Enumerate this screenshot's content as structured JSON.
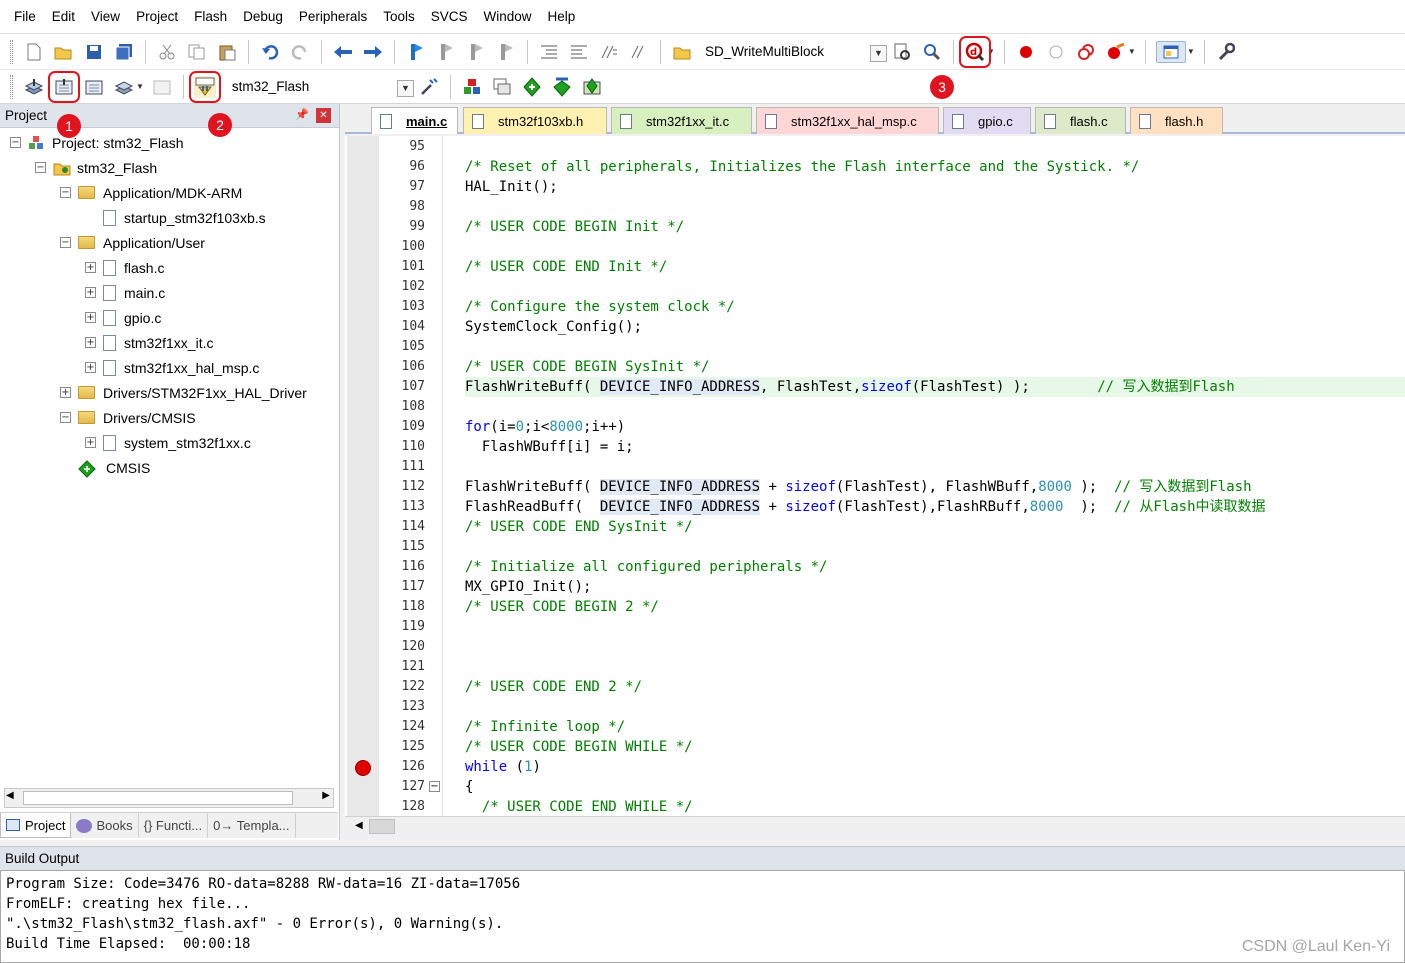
{
  "menubar": {
    "items": [
      "File",
      "Edit",
      "View",
      "Project",
      "Flash",
      "Debug",
      "Peripherals",
      "Tools",
      "SVCS",
      "Window",
      "Help"
    ]
  },
  "toolbar1": {
    "target_combo": "SD_WriteMultiBlock",
    "icons": [
      "new-file-icon",
      "open-icon",
      "save-icon",
      "save-all-icon",
      "cut-icon",
      "copy-icon",
      "paste-icon",
      "undo-icon",
      "redo-icon",
      "nav-back-icon",
      "nav-forward-icon",
      "bookmark-icon",
      "prev-bookmark-icon",
      "next-bookmark-icon",
      "clear-bookmarks-icon",
      "indent-icon",
      "unindent-icon",
      "comment-icon",
      "uncomment-icon",
      "find-in-files-icon",
      "find-icon",
      "incremental-find-icon",
      "debug-session-icon",
      "breakpoint-icon",
      "disable-breakpoint-icon",
      "disable-all-breakpoints-icon",
      "kill-breakpoints-icon",
      "window-layout-icon",
      "configure-icon"
    ]
  },
  "toolbar2": {
    "target_combo": "stm32_Flash",
    "icons": [
      "translate-icon",
      "build-icon",
      "rebuild-icon",
      "batch-build-icon",
      "stop-build-icon",
      "download-icon",
      "target-options-icon",
      "manage-components-icon",
      "file-extensions-icon",
      "select-packs-icon",
      "pack-installer-icon",
      "event-recorder-icon"
    ],
    "download_label": "LOAD"
  },
  "badges": [
    "1",
    "2",
    "3"
  ],
  "project_panel": {
    "title": "Project",
    "tree": [
      {
        "label": "Project: stm32_Flash",
        "level": 0,
        "expander": "⊟",
        "icon": "project"
      },
      {
        "label": "stm32_Flash",
        "level": 1,
        "expander": "⊟",
        "icon": "target"
      },
      {
        "label": "Application/MDK-ARM",
        "level": 2,
        "expander": "⊟",
        "icon": "folder"
      },
      {
        "label": "startup_stm32f103xb.s",
        "level": 3,
        "expander": "",
        "icon": "file"
      },
      {
        "label": "Application/User",
        "level": 2,
        "expander": "⊟",
        "icon": "folder"
      },
      {
        "label": "flash.c",
        "level": 3,
        "expander": "⊞",
        "icon": "file"
      },
      {
        "label": "main.c",
        "level": 3,
        "expander": "⊞",
        "icon": "file"
      },
      {
        "label": "gpio.c",
        "level": 3,
        "expander": "⊞",
        "icon": "file"
      },
      {
        "label": "stm32f1xx_it.c",
        "level": 3,
        "expander": "⊞",
        "icon": "file"
      },
      {
        "label": "stm32f1xx_hal_msp.c",
        "level": 3,
        "expander": "⊞",
        "icon": "file"
      },
      {
        "label": "Drivers/STM32F1xx_HAL_Driver",
        "level": 2,
        "expander": "⊞",
        "icon": "folder"
      },
      {
        "label": "Drivers/CMSIS",
        "level": 2,
        "expander": "⊟",
        "icon": "folder"
      },
      {
        "label": "system_stm32f1xx.c",
        "level": 3,
        "expander": "⊞",
        "icon": "file"
      },
      {
        "label": "CMSIS",
        "level": 2,
        "expander": "",
        "icon": "diamond"
      }
    ],
    "bottom_tabs": [
      "Project",
      "Books",
      "{} Functi...",
      "0→ Templa..."
    ]
  },
  "editor": {
    "tabs": [
      {
        "label": "main.c",
        "color": "#ffffff",
        "active": true
      },
      {
        "label": "stm32f103xb.h",
        "color": "#fff1b0"
      },
      {
        "label": "stm32f1xx_it.c",
        "color": "#d8f0c0"
      },
      {
        "label": "stm32f1xx_hal_msp.c",
        "color": "#ffd6d6"
      },
      {
        "label": "gpio.c",
        "color": "#e2dcf2"
      },
      {
        "label": "flash.c",
        "color": "#dde9c8"
      },
      {
        "label": "flash.h",
        "color": "#ffe0c0"
      }
    ],
    "line_numbers": [
      "95",
      "96",
      "97",
      "98",
      "99",
      "100",
      "101",
      "102",
      "103",
      "104",
      "105",
      "106",
      "107",
      "108",
      "109",
      "110",
      "111",
      "112",
      "113",
      "114",
      "115",
      "116",
      "117",
      "118",
      "119",
      "120",
      "121",
      "122",
      "123",
      "124",
      "125",
      "126",
      "127",
      "128"
    ],
    "lines": [
      "",
      "/* Reset of all peripherals, Initializes the Flash interface and the Systick. */",
      "HAL_Init();",
      "",
      "/* USER CODE BEGIN Init */",
      "",
      "/* USER CODE END Init */",
      "",
      "/* Configure the system clock */",
      "SystemClock_Config();",
      "",
      "/* USER CODE BEGIN SysInit */",
      "FlashWriteBuff( DEVICE_INFO_ADDRESS, FlashTest,sizeof(FlashTest) );        // 写入数据到Flash",
      "",
      "for(i=0;i<8000;i++)",
      "  FlashWBuff[i] = i;",
      "",
      "FlashWriteBuff( DEVICE_INFO_ADDRESS + sizeof(FlashTest), FlashWBuff,8000 );  // 写入数据到Flash",
      "FlashReadBuff(  DEVICE_INFO_ADDRESS + sizeof(FlashTest),FlashRBuff,8000  );  // 从Flash中读取数据",
      "/* USER CODE END SysInit */",
      "",
      "/* Initialize all configured peripherals */",
      "MX_GPIO_Init();",
      "/* USER CODE BEGIN 2 */",
      "",
      "",
      "",
      "/* USER CODE END 2 */",
      "",
      "/* Infinite loop */",
      "/* USER CODE BEGIN WHILE */",
      "while (1)",
      "{",
      "  /* USER CODE END WHILE */"
    ]
  },
  "build_output": {
    "title": "Build Output",
    "lines": [
      "Program Size: Code=3476 RO-data=8288 RW-data=16 ZI-data=17056",
      "FromELF: creating hex file...",
      "\".\\stm32_Flash\\stm32_flash.axf\" - 0 Error(s), 0 Warning(s).",
      "Build Time Elapsed:  00:00:18"
    ]
  },
  "watermark": "CSDN @Laul Ken-Yi",
  "colors": {
    "accent_red": "#e0141e",
    "comment_green": "#008000",
    "keyword_blue": "#0000ff",
    "number_teal": "#2b91af"
  }
}
